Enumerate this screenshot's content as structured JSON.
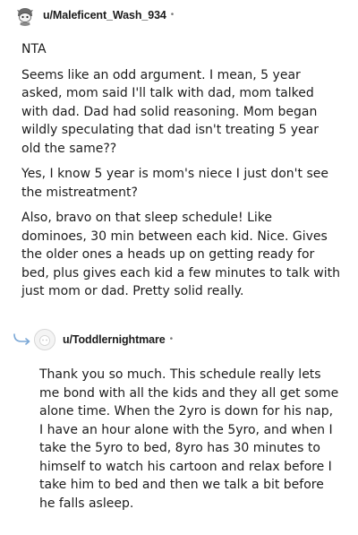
{
  "comments": [
    {
      "username": "u/Maleficent_Wash_934",
      "separator": "•",
      "paragraphs": [
        "NTA",
        "Seems like an odd argument. I mean, 5 year asked, mom said I'll talk with dad, mom talked with dad. Dad had solid reasoning. Mom began wildly speculating that dad isn't treating 5 year old the same??",
        "Yes, I know 5 year is mom's niece I just don't see the mistreatment?",
        "Also, bravo on that sleep schedule! Like dominoes, 30 min between each kid. Nice. Gives the older ones a heads up on getting ready for bed, plus gives each kid a few minutes to talk with just mom or dad. Pretty solid really."
      ]
    },
    {
      "username": "u/Toddlernightmare",
      "separator": "•",
      "paragraphs": [
        "Thank you so much. This schedule really lets me bond with all the kids and they all get some alone time. When the 2yro is down for his nap, I have an hour alone with the 5yro, and when I take the 5yro to bed, 8yro has 30 minutes to himself to watch his cartoon and relax before I take him to bed and then we talk a bit before he falls asleep."
      ]
    }
  ],
  "colors": {
    "text": "#1c1c1c",
    "meta": "#7c7c7c",
    "reply_arrow": "#7aa7d6"
  }
}
